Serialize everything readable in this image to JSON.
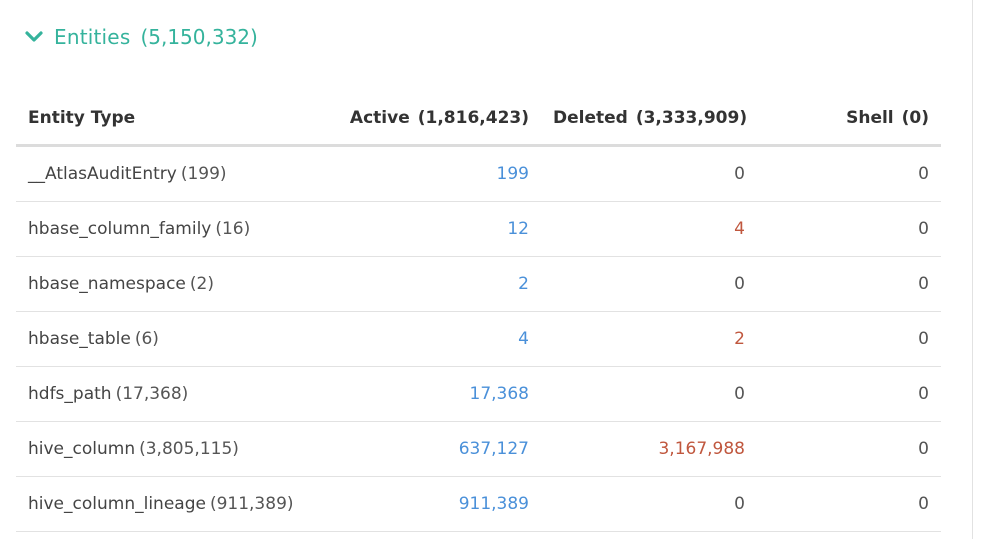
{
  "section": {
    "title": "Entities",
    "count": "(5,150,332)",
    "icon": "chevron-down-icon",
    "accent_color": "#35b39c"
  },
  "table": {
    "headers": {
      "type": "Entity Type",
      "active_label": "Active",
      "active_count": "(1,816,423)",
      "deleted_label": "Deleted",
      "deleted_count": "(3,333,909)",
      "shell_label": "Shell",
      "shell_count": "(0)"
    },
    "colors": {
      "active": "#4a90d9",
      "deleted": "#c0573e"
    },
    "rows": [
      {
        "name": "__AtlasAuditEntry",
        "total": "(199)",
        "active": "199",
        "deleted": "0",
        "shell": "0"
      },
      {
        "name": "hbase_column_family",
        "total": "(16)",
        "active": "12",
        "deleted": "4",
        "shell": "0"
      },
      {
        "name": "hbase_namespace",
        "total": "(2)",
        "active": "2",
        "deleted": "0",
        "shell": "0"
      },
      {
        "name": "hbase_table",
        "total": "(6)",
        "active": "4",
        "deleted": "2",
        "shell": "0"
      },
      {
        "name": "hdfs_path",
        "total": "(17,368)",
        "active": "17,368",
        "deleted": "0",
        "shell": "0"
      },
      {
        "name": "hive_column",
        "total": "(3,805,115)",
        "active": "637,127",
        "deleted": "3,167,988",
        "shell": "0"
      },
      {
        "name": "hive_column_lineage",
        "total": "(911,389)",
        "active": "911,389",
        "deleted": "0",
        "shell": "0"
      }
    ]
  }
}
